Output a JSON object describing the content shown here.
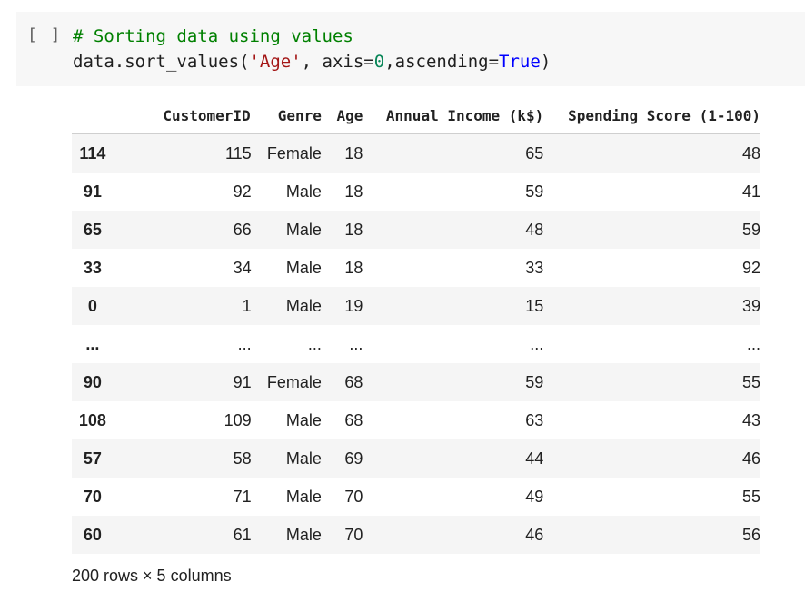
{
  "cell": {
    "run_bracket": "[ ]",
    "code_comment": "# Sorting data using values",
    "code_line2_parts": {
      "a": "data.sort_values(",
      "b": "'Age'",
      "c": ", axis=",
      "d": "0",
      "e": ",ascending=",
      "f": "True",
      "g": ")"
    }
  },
  "table": {
    "columns": [
      "",
      "CustomerID",
      "Genre",
      "Age",
      "Annual Income (k$)",
      "Spending Score (1-100)"
    ],
    "rows": [
      [
        "114",
        "115",
        "Female",
        "18",
        "65",
        "48"
      ],
      [
        "91",
        "92",
        "Male",
        "18",
        "59",
        "41"
      ],
      [
        "65",
        "66",
        "Male",
        "18",
        "48",
        "59"
      ],
      [
        "33",
        "34",
        "Male",
        "18",
        "33",
        "92"
      ],
      [
        "0",
        "1",
        "Male",
        "19",
        "15",
        "39"
      ],
      [
        "...",
        "...",
        "...",
        "...",
        "...",
        "..."
      ],
      [
        "90",
        "91",
        "Female",
        "68",
        "59",
        "55"
      ],
      [
        "108",
        "109",
        "Male",
        "68",
        "63",
        "43"
      ],
      [
        "57",
        "58",
        "Male",
        "69",
        "44",
        "46"
      ],
      [
        "70",
        "71",
        "Male",
        "70",
        "49",
        "55"
      ],
      [
        "60",
        "61",
        "Male",
        "70",
        "46",
        "56"
      ]
    ]
  },
  "shape_text": "200 rows × 5 columns"
}
